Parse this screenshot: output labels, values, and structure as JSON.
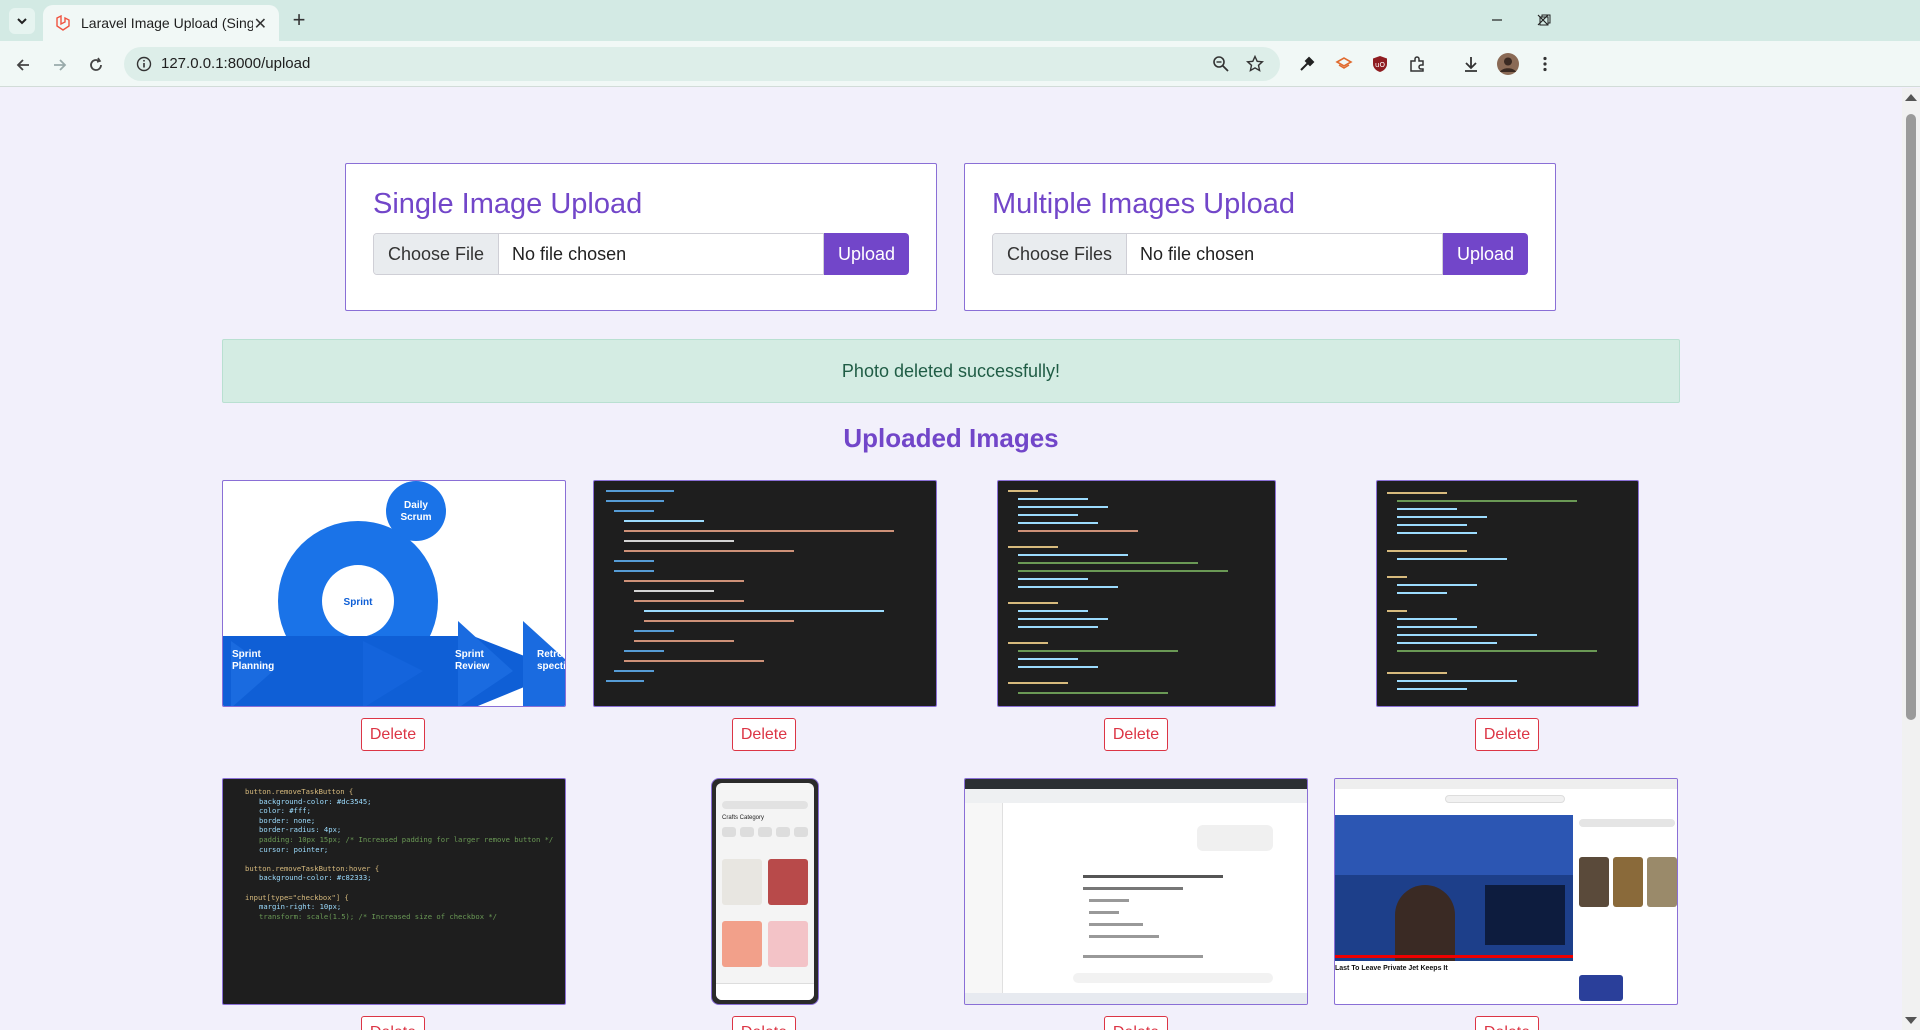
{
  "browser": {
    "tab_title": "Laravel Image Upload (Single +",
    "url": "127.0.0.1:8000/upload"
  },
  "single_upload": {
    "title": "Single Image Upload",
    "choose_label": "Choose File",
    "status": "No file chosen",
    "upload_label": "Upload"
  },
  "multiple_upload": {
    "title": "Multiple Images Upload",
    "choose_label": "Choose Files",
    "status": "No file chosen",
    "upload_label": "Upload"
  },
  "alert": {
    "message": "Photo deleted successfully!"
  },
  "gallery": {
    "title": "Uploaded Images",
    "delete_label": "Delete",
    "scrum_labels": {
      "daily": "Daily Scrum",
      "sprint": "Sprint",
      "planning": "Sprint Planning",
      "review": "Sprint Review",
      "retro": "Retro-spectiv"
    },
    "code_snippet": {
      "l1": "button.removeTaskButton {",
      "l2": "background-color: #dc3545;",
      "l3": "color: #fff;",
      "l4": "border: none;",
      "l5": "border-radius: 4px;",
      "l6": "padding: 10px 15px; /* Increased padding for larger remove button */",
      "l7": "cursor: pointer;",
      "l8": "button.removeTaskButton:hover {",
      "l9": "background-color: #c82333;",
      "l10": "input[type=\"checkbox\"] {",
      "l11": "margin-right: 10px;",
      "l12": "transform: scale(1.5); /* Increased size of checkbox */"
    },
    "phone_header": "Crafts Category",
    "video_caption": "Last To Leave Private Jet Keeps It"
  },
  "colors": {
    "accent": "#7246c9",
    "alert_bg": "#d4ece3",
    "danger": "#dc3545"
  }
}
